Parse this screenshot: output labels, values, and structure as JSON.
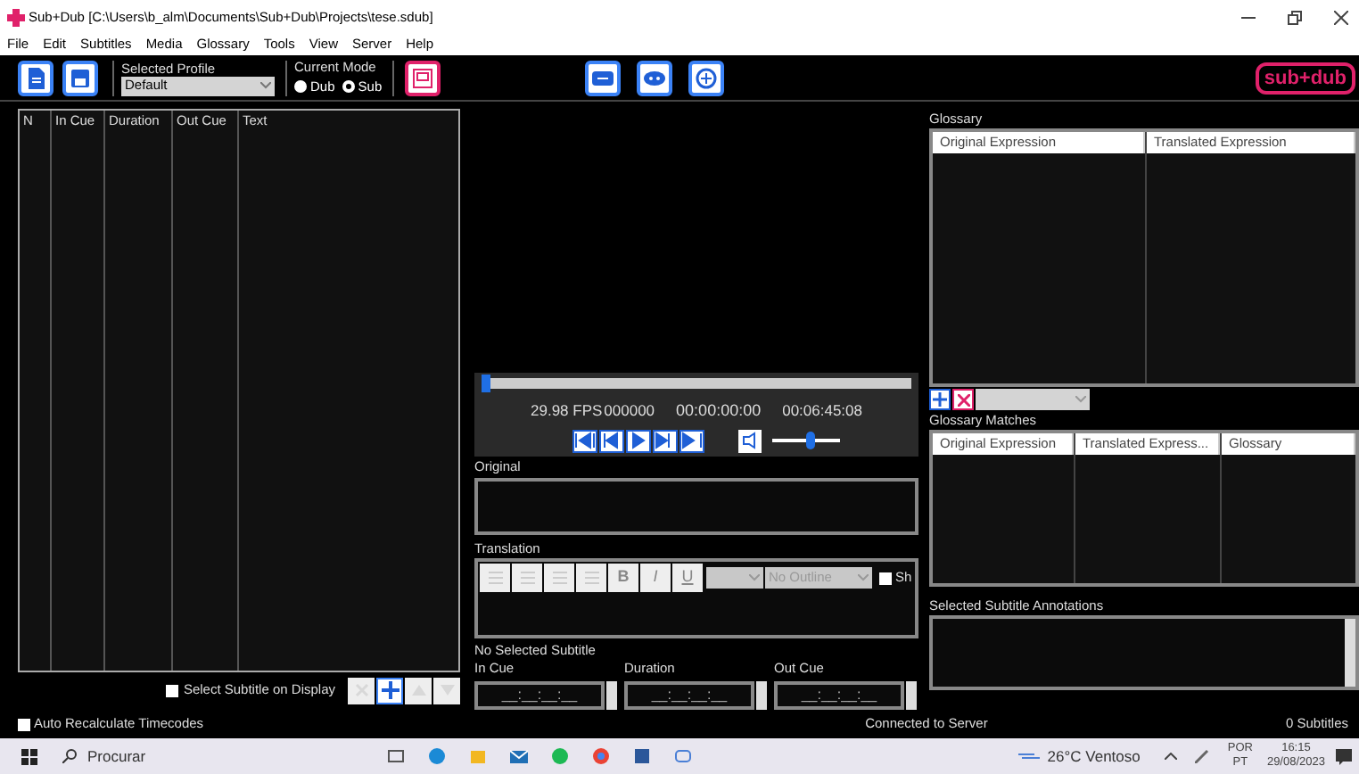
{
  "window": {
    "title": "Sub+Dub [C:\\Users\\b_alm\\Documents\\Sub+Dub\\Projects\\tese.sdub]"
  },
  "menu": [
    "File",
    "Edit",
    "Subtitles",
    "Media",
    "Glossary",
    "Tools",
    "View",
    "Server",
    "Help"
  ],
  "toolbar": {
    "profile": {
      "label": "Selected Profile",
      "value": "Default"
    },
    "mode": {
      "label": "Current Mode",
      "options": [
        {
          "label": "Dub",
          "selected": false
        },
        {
          "label": "Sub",
          "selected": true
        }
      ]
    },
    "logo": "sub+dub"
  },
  "subtitle_list": {
    "columns": [
      "N",
      "In Cue",
      "Duration",
      "Out Cue",
      "Text"
    ],
    "select_on_display": {
      "label": "Select Subtitle on Display",
      "checked": false
    },
    "buttons": [
      {
        "kind": "delete",
        "disabled": true
      },
      {
        "kind": "add",
        "disabled": false
      },
      {
        "kind": "up",
        "disabled": true
      },
      {
        "kind": "down",
        "disabled": true
      }
    ]
  },
  "player": {
    "seek": {
      "level": 0.0
    },
    "fps": "29.98 FPS",
    "frame": "000000",
    "position": "00:00:00:00",
    "duration": "00:06:45:08",
    "volume": {
      "level": 0.55
    }
  },
  "original": {
    "label": "Original"
  },
  "translation": {
    "label": "Translation",
    "format_buttons": [
      {
        "kind": "align"
      },
      {
        "kind": "align"
      },
      {
        "kind": "align"
      },
      {
        "kind": "align"
      },
      {
        "kind": "text",
        "text": "B"
      },
      {
        "kind": "text",
        "text": "I"
      },
      {
        "kind": "text",
        "text": "U"
      }
    ],
    "outline": "No Outline",
    "show": {
      "label": "Sh",
      "checked": false
    }
  },
  "cue": {
    "status": "No Selected Subtitle",
    "fields": [
      {
        "label": "In Cue",
        "value": "__:__:__:__"
      },
      {
        "label": "Duration",
        "value": "__:__:__:__"
      },
      {
        "label": "Out Cue",
        "value": "__:__:__:__"
      }
    ]
  },
  "glossary": {
    "label": "Glossary",
    "columns": [
      "Original Expression",
      "Translated Expression"
    ]
  },
  "glossary_matches": {
    "label": "Glossary Matches",
    "columns": [
      "Original Expression",
      "Translated Express...",
      "Glossary"
    ]
  },
  "annotations": {
    "label": "Selected Subtitle Annotations"
  },
  "status_bar": {
    "auto_recalculate": {
      "label": "Auto Recalculate Timecodes",
      "checked": false
    },
    "connection": "Connected to Server",
    "count": "0 Subtitles"
  },
  "taskbar": {
    "search": "Procurar",
    "weather": "26°C Ventoso",
    "language": "POR",
    "region": "PT",
    "time": "16:15",
    "date": "29/08/2023"
  }
}
